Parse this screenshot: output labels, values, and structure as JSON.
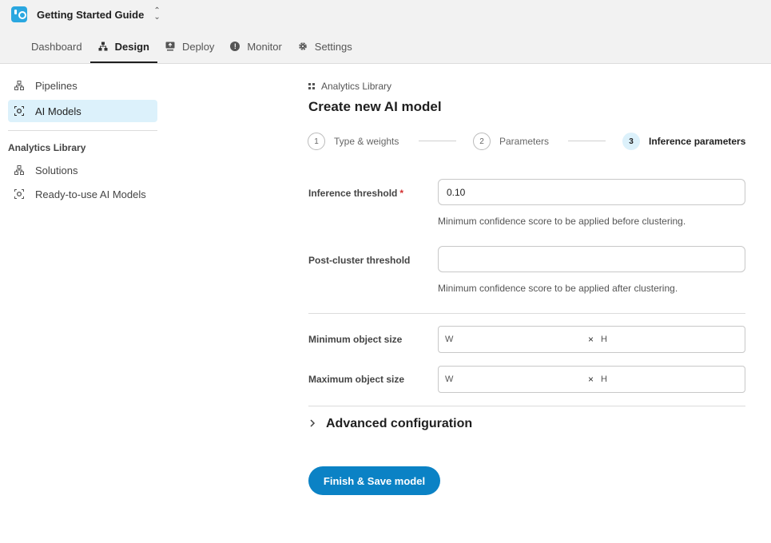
{
  "app": {
    "title": "Getting Started Guide",
    "switch_icon": "chevron-up-down-icon"
  },
  "nav": {
    "tabs": [
      {
        "label": "Dashboard",
        "icon": "dashboard-icon"
      },
      {
        "label": "Design",
        "icon": "design-icon",
        "active": true
      },
      {
        "label": "Deploy",
        "icon": "deploy-icon"
      },
      {
        "label": "Monitor",
        "icon": "monitor-icon"
      },
      {
        "label": "Settings",
        "icon": "settings-icon"
      }
    ]
  },
  "sidebar": {
    "items": [
      {
        "label": "Pipelines",
        "icon": "pipeline-icon"
      },
      {
        "label": "AI Models",
        "icon": "ai-model-icon",
        "active": true
      }
    ],
    "section_title": "Analytics Library",
    "section_items": [
      {
        "label": "Solutions",
        "icon": "pipeline-icon"
      },
      {
        "label": "Ready-to-use AI Models",
        "icon": "ai-model-icon"
      }
    ]
  },
  "main": {
    "breadcrumb": "Analytics Library",
    "title": "Create new AI model",
    "steps": [
      {
        "number": "1",
        "label": "Type & weights"
      },
      {
        "number": "2",
        "label": "Parameters"
      },
      {
        "number": "3",
        "label": "Inference parameters",
        "active": true
      }
    ],
    "fields": {
      "inference_threshold": {
        "label": "Inference threshold",
        "required_mark": "*",
        "value": "0.10",
        "hint": "Minimum confidence score to be applied before clustering."
      },
      "post_cluster_threshold": {
        "label": "Post-cluster threshold",
        "value": "",
        "hint": "Minimum confidence score to be applied after clustering."
      },
      "min_object_size": {
        "label": "Minimum object size",
        "w": "W",
        "times": "×",
        "h": "H"
      },
      "max_object_size": {
        "label": "Maximum object size",
        "w": "W",
        "times": "×",
        "h": "H"
      }
    },
    "advanced": {
      "label": "Advanced configuration",
      "chevron": "›"
    },
    "submit": {
      "label": "Finish & Save model"
    }
  },
  "colors": {
    "accent": "#0b82c5",
    "active_bg": "#dcf1fb",
    "logo": "#2aa7e0",
    "required": "#d32f2f"
  }
}
